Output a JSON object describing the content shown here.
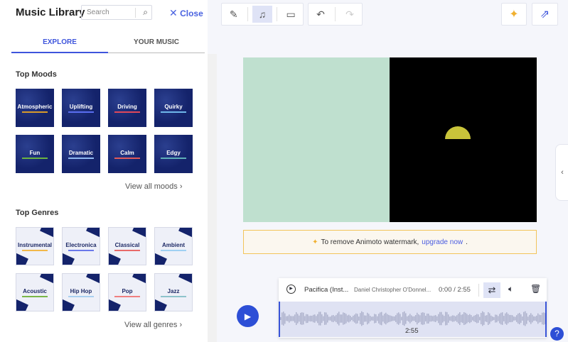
{
  "panel": {
    "title": "Music Library",
    "search_placeholder": "Search",
    "close_label": "Close"
  },
  "tabs": [
    {
      "label": "EXPLORE",
      "active": true
    },
    {
      "label": "YOUR MUSIC",
      "active": false
    }
  ],
  "moods": {
    "heading": "Top Moods",
    "items": [
      {
        "label": "Atmospheric",
        "color": "#d79a2a"
      },
      {
        "label": "Uplifting",
        "color": "#5a6ef0"
      },
      {
        "label": "Driving",
        "color": "#e0485a"
      },
      {
        "label": "Quirky",
        "color": "#6fb7ea"
      },
      {
        "label": "Fun",
        "color": "#6bb341"
      },
      {
        "label": "Dramatic",
        "color": "#8fb9f0"
      },
      {
        "label": "Calm",
        "color": "#e05a5a"
      },
      {
        "label": "Edgy",
        "color": "#5fb0b8"
      }
    ],
    "view_all": "View all moods"
  },
  "genres": {
    "heading": "Top Genres",
    "items": [
      {
        "label": "Instrumental",
        "color": "#f2b84a"
      },
      {
        "label": "Electronica",
        "color": "#6a78ea"
      },
      {
        "label": "Classical",
        "color": "#e86a6a"
      },
      {
        "label": "Ambient",
        "color": "#9fd0f2"
      },
      {
        "label": "Acoustic",
        "color": "#7ab648"
      },
      {
        "label": "Hip Hop",
        "color": "#a9d0f0"
      },
      {
        "label": "Pop",
        "color": "#f08080"
      },
      {
        "label": "Jazz",
        "color": "#8ec4cc"
      }
    ],
    "view_all": "View all genres"
  },
  "watermark": {
    "text": "To remove Animoto watermark, ",
    "link": "upgrade now",
    "suffix": "."
  },
  "track": {
    "title": "Pacifica (Inst...",
    "artist": "Daniel Christopher O'Donnel...",
    "time": "0:00 / 2:55",
    "duration": "2:55"
  },
  "help": "?",
  "colors": {
    "accent": "#2d4fd6",
    "preview_left": "#bfe0cf"
  }
}
